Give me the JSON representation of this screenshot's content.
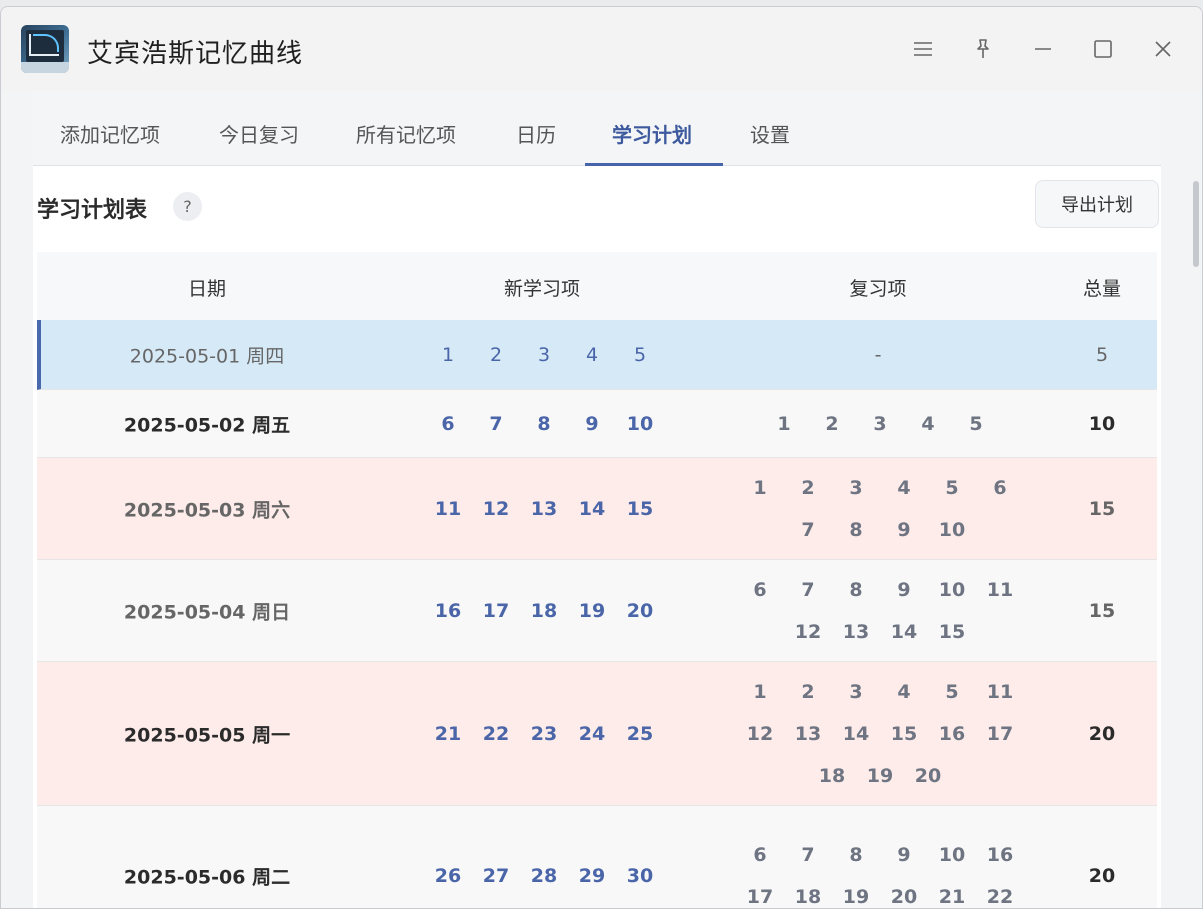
{
  "app": {
    "title": "艾宾浩斯记忆曲线"
  },
  "tabs": [
    {
      "label": "添加记忆项",
      "active": false
    },
    {
      "label": "今日复习",
      "active": false
    },
    {
      "label": "所有记忆项",
      "active": false
    },
    {
      "label": "日历",
      "active": false
    },
    {
      "label": "学习计划",
      "active": true
    },
    {
      "label": "设置",
      "active": false
    }
  ],
  "plan": {
    "title": "学习计划表",
    "help_glyph": "?",
    "export_label": "导出计划"
  },
  "table": {
    "headers": {
      "date": "日期",
      "new_items": "新学习项",
      "review_items": "复习项",
      "total": "总量"
    },
    "empty_review": "-",
    "rows": [
      {
        "date": "2025-05-01 周四",
        "new": [
          "1",
          "2",
          "3",
          "4",
          "5"
        ],
        "review": [],
        "total": "5",
        "style": "selected"
      },
      {
        "date": "2025-05-02 周五",
        "new": [
          "6",
          "7",
          "8",
          "9",
          "10"
        ],
        "review": [
          "1",
          "2",
          "3",
          "4",
          "5"
        ],
        "total": "10",
        "style": "plain"
      },
      {
        "date": "2025-05-03 周六",
        "new": [
          "11",
          "12",
          "13",
          "14",
          "15"
        ],
        "review": [
          "1",
          "2",
          "3",
          "4",
          "5",
          "6",
          "7",
          "8",
          "9",
          "10"
        ],
        "total": "15",
        "style": "weekend"
      },
      {
        "date": "2025-05-04 周日",
        "new": [
          "16",
          "17",
          "18",
          "19",
          "20"
        ],
        "review": [
          "6",
          "7",
          "8",
          "9",
          "10",
          "11",
          "12",
          "13",
          "14",
          "15"
        ],
        "total": "15",
        "style": "plain"
      },
      {
        "date": "2025-05-05 周一",
        "new": [
          "21",
          "22",
          "23",
          "24",
          "25"
        ],
        "review": [
          "1",
          "2",
          "3",
          "4",
          "5",
          "11",
          "12",
          "13",
          "14",
          "15",
          "16",
          "17",
          "18",
          "19",
          "20"
        ],
        "total": "20",
        "style": "weekend"
      },
      {
        "date": "2025-05-06 周二",
        "new": [
          "26",
          "27",
          "28",
          "29",
          "30"
        ],
        "review": [
          "6",
          "7",
          "8",
          "9",
          "10",
          "16",
          "17",
          "18",
          "19",
          "20",
          "21",
          "22"
        ],
        "total": "20",
        "style": "plain"
      }
    ]
  },
  "icons": {
    "menu": "menu-icon",
    "pin": "pin-icon",
    "minimize": "minimize-icon",
    "maximize": "maximize-icon",
    "close": "close-icon"
  }
}
